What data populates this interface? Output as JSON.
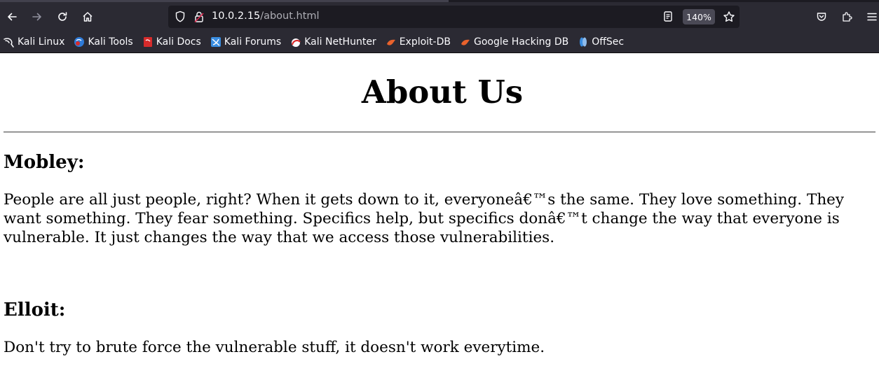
{
  "browser": {
    "url_host": "10.0.2.15",
    "url_path": "/about.html",
    "zoom": "140%",
    "icons": [
      "back-icon",
      "forward-icon",
      "reload-icon",
      "home-icon",
      "shield-icon",
      "lock-icon",
      "reader-view-icon",
      "star-icon",
      "pocket-icon",
      "extensions-icon",
      "menu-icon"
    ],
    "bookmarks": [
      {
        "label": "Kali Linux",
        "icon": "kali-dragon-icon",
        "color": "#fbfbfe"
      },
      {
        "label": "Kali Tools",
        "icon": "kali-tools-icon",
        "color": "#2f7bd8"
      },
      {
        "label": "Kali Docs",
        "icon": "kali-docs-icon",
        "color": "#d62b2b"
      },
      {
        "label": "Kali Forums",
        "icon": "kali-forums-icon",
        "color": "#3a8de0"
      },
      {
        "label": "Kali NetHunter",
        "icon": "nethunter-icon",
        "color": "#d92a2a"
      },
      {
        "label": "Exploit-DB",
        "icon": "exploit-db-icon",
        "color": "#e8622c"
      },
      {
        "label": "Google Hacking DB",
        "icon": "ghdb-icon",
        "color": "#e8622c"
      },
      {
        "label": "OffSec",
        "icon": "offsec-icon",
        "color": "#3a8de0"
      }
    ]
  },
  "page": {
    "title": "About Us",
    "sections": [
      {
        "heading": "Mobley:",
        "text": "People are all just people, right? When it gets down to it, everyoneâ€™s the same. They love something. They want something. They fear something. Specifics help, but specifics donâ€™t change the way that everyone is vulnerable. It just changes the way that we access those vulnerabilities."
      },
      {
        "heading": "Elloit:",
        "text": "Don't try to brute force the vulnerable stuff, it doesn't work everytime."
      }
    ]
  }
}
